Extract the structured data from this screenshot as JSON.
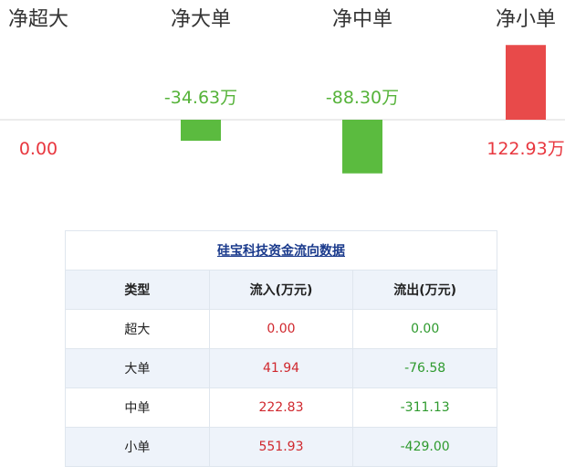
{
  "chart_data": {
    "type": "bar",
    "categories": [
      "净超大",
      "净大单",
      "净中单",
      "净小单"
    ],
    "values": [
      0.0,
      -34.63,
      -88.3,
      122.93
    ],
    "value_labels": [
      "0.00",
      "-34.63万",
      "-88.30万",
      "122.93万"
    ],
    "colors": {
      "positive": "#e84a4a",
      "negative": "#5bbb3f",
      "positive_label": "#e8373f",
      "negative_label": "#56b33a",
      "zero_label": "#e8373f",
      "category_label": "#333333",
      "baseline": "#d9d9d9"
    },
    "ylim": [
      -130,
      180
    ],
    "grid": false
  },
  "table": {
    "title": "硅宝科技资金流向数据",
    "headers": [
      "类型",
      "流入(万元)",
      "流出(万元)"
    ],
    "rows": [
      {
        "type": "超大",
        "in": "0.00",
        "out": "0.00"
      },
      {
        "type": "大单",
        "in": "41.94",
        "out": "-76.58"
      },
      {
        "type": "中单",
        "in": "222.83",
        "out": "-311.13"
      },
      {
        "type": "小单",
        "in": "551.93",
        "out": "-429.00"
      }
    ]
  }
}
